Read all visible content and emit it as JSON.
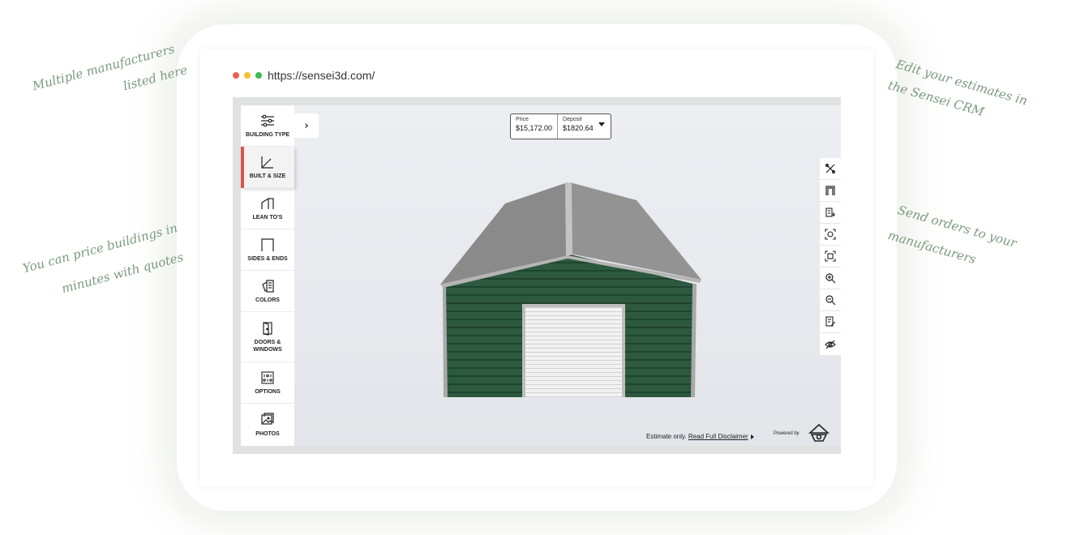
{
  "browser": {
    "url": "https://sensei3d.com/"
  },
  "annotations": {
    "manufacturers_line1": "Multiple manufacturers",
    "manufacturers_line2": "listed here",
    "price_line1": "You can price buildings in",
    "price_line2": "minutes with quotes",
    "crm_line1": "Edit your estimates in",
    "crm_line2": "the Sensei CRM",
    "orders_line1": "Send orders to your",
    "orders_line2": "manufacturers"
  },
  "sidebar": {
    "items": [
      {
        "label": "BUILDING TYPE",
        "icon": "sliders-icon"
      },
      {
        "label": "BUILT & SIZE",
        "icon": "ruler-angle-icon",
        "active": true
      },
      {
        "label": "LEAN TO'S",
        "icon": "lean-to-icon"
      },
      {
        "label": "SIDES & ENDS",
        "icon": "frame-icon"
      },
      {
        "label": "COLORS",
        "icon": "swatches-icon"
      },
      {
        "label": "DOORS & WINDOWS",
        "icon": "door-icon"
      },
      {
        "label": "OPTIONS",
        "icon": "options-grid-icon"
      },
      {
        "label": "PHOTOS",
        "icon": "photos-icon"
      }
    ],
    "expand_glyph": "›"
  },
  "price": {
    "price_label": "Price",
    "price_value": "$15,172.00",
    "deposit_label": "Deposit",
    "deposit_value": "$1820.64"
  },
  "toolbar": {
    "tools": [
      "crossed-tools-icon",
      "frame-front-icon",
      "building-add-icon",
      "focus-icon",
      "fit-screen-icon",
      "zoom-in-icon",
      "zoom-out-icon",
      "edit-note-icon",
      "hide-eye-icon"
    ]
  },
  "footer": {
    "estimate_text": "Estimate only.",
    "disclaimer_link": "Read Full Disclaimer",
    "powered_by": "Powered by"
  },
  "colors": {
    "wall_green": "#2d5a3f",
    "roof_gray": "#8e8e8e",
    "accent_red": "#d9534f",
    "annotation_green": "#7a9a7e"
  }
}
